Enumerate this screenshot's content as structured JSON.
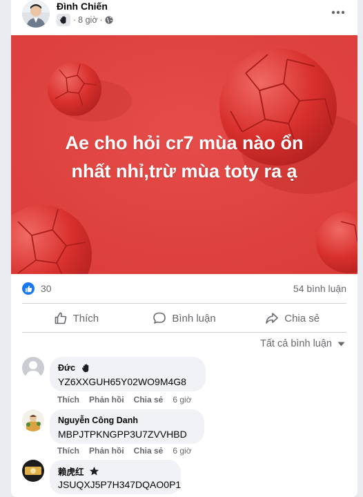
{
  "post": {
    "author": "Đình Chiến",
    "time": "8 giờ",
    "separator": "·",
    "caption_line1": "Ae cho hỏi cr7 mùa nào ổn",
    "caption_line2": "nhất nhỉ,trừ mùa toty ra ạ",
    "image_background": "#e04442"
  },
  "stats": {
    "reactions": "30",
    "comments": "54 bình luận"
  },
  "actions": {
    "like": "Thích",
    "comment": "Bình luận",
    "share": "Chia sẻ"
  },
  "filter": {
    "label": "Tất cả bình luận"
  },
  "comments": [
    {
      "name": "Đức",
      "badge": "wave-badge-icon",
      "text": "YZ6XXGUH65Y02WO9M4G8",
      "like": "Thích",
      "reply": "Phản hồi",
      "share": "Chia sẻ",
      "time": "6 giờ"
    },
    {
      "name": "Nguyễn Công Danh",
      "text": "MBPJTPKNGPP3U7ZVVHBD",
      "like": "Thích",
      "reply": "Phản hồi",
      "share": "Chia sẻ",
      "time": "6 giờ"
    },
    {
      "name": "赖虎红",
      "badge": "star-badge-icon",
      "text": "JSUQXJ5P7H347DQAO0P1"
    }
  ],
  "colors": {
    "accent": "#1877f2",
    "secondary_text": "#65676b",
    "bubble": "#f0f2f5"
  }
}
